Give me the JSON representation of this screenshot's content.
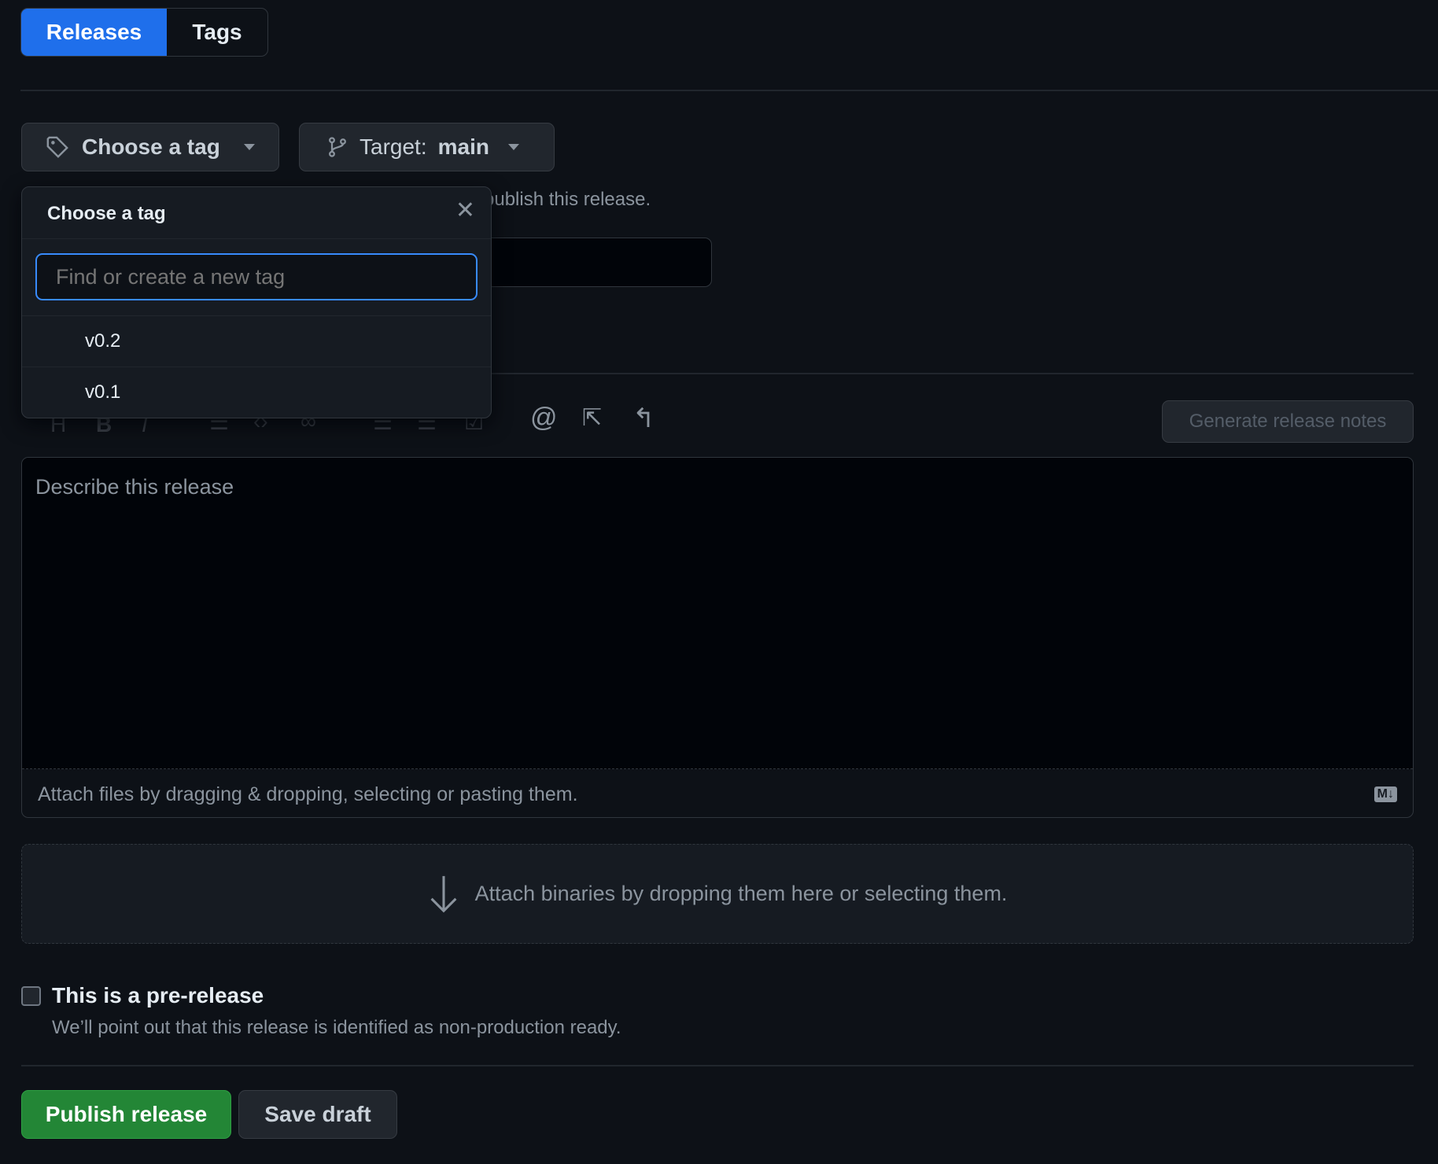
{
  "tabs": [
    {
      "label": "Releases",
      "active": true
    },
    {
      "label": "Tags",
      "active": false
    }
  ],
  "tag_button": {
    "label": "Choose a tag",
    "icon": "tag-icon"
  },
  "target_button": {
    "prefix": "Target:",
    "branch": "main",
    "icon": "git-branch-icon"
  },
  "helper_text": "publish this release.",
  "tag_popup": {
    "title": "Choose a tag",
    "search_placeholder": "Find or create a new tag",
    "search_value": "",
    "items": [
      "v0.2",
      "v0.1"
    ]
  },
  "toolbar": {
    "generate_label": "Generate release notes"
  },
  "description": {
    "placeholder": "Describe this release",
    "attach_text": "Attach files by dragging & dropping, selecting or pasting them.",
    "markdown_badge": "M↓"
  },
  "binaries": {
    "text": "Attach binaries by dropping them here or selecting them."
  },
  "prerelease": {
    "label": "This is a pre-release",
    "description": "We’ll point out that this release is identified as non-production ready.",
    "checked": false
  },
  "actions": {
    "publish": "Publish release",
    "save_draft": "Save draft"
  },
  "colors": {
    "accent": "#1f6feb",
    "publish": "#238636",
    "focus": "#388bfd"
  }
}
